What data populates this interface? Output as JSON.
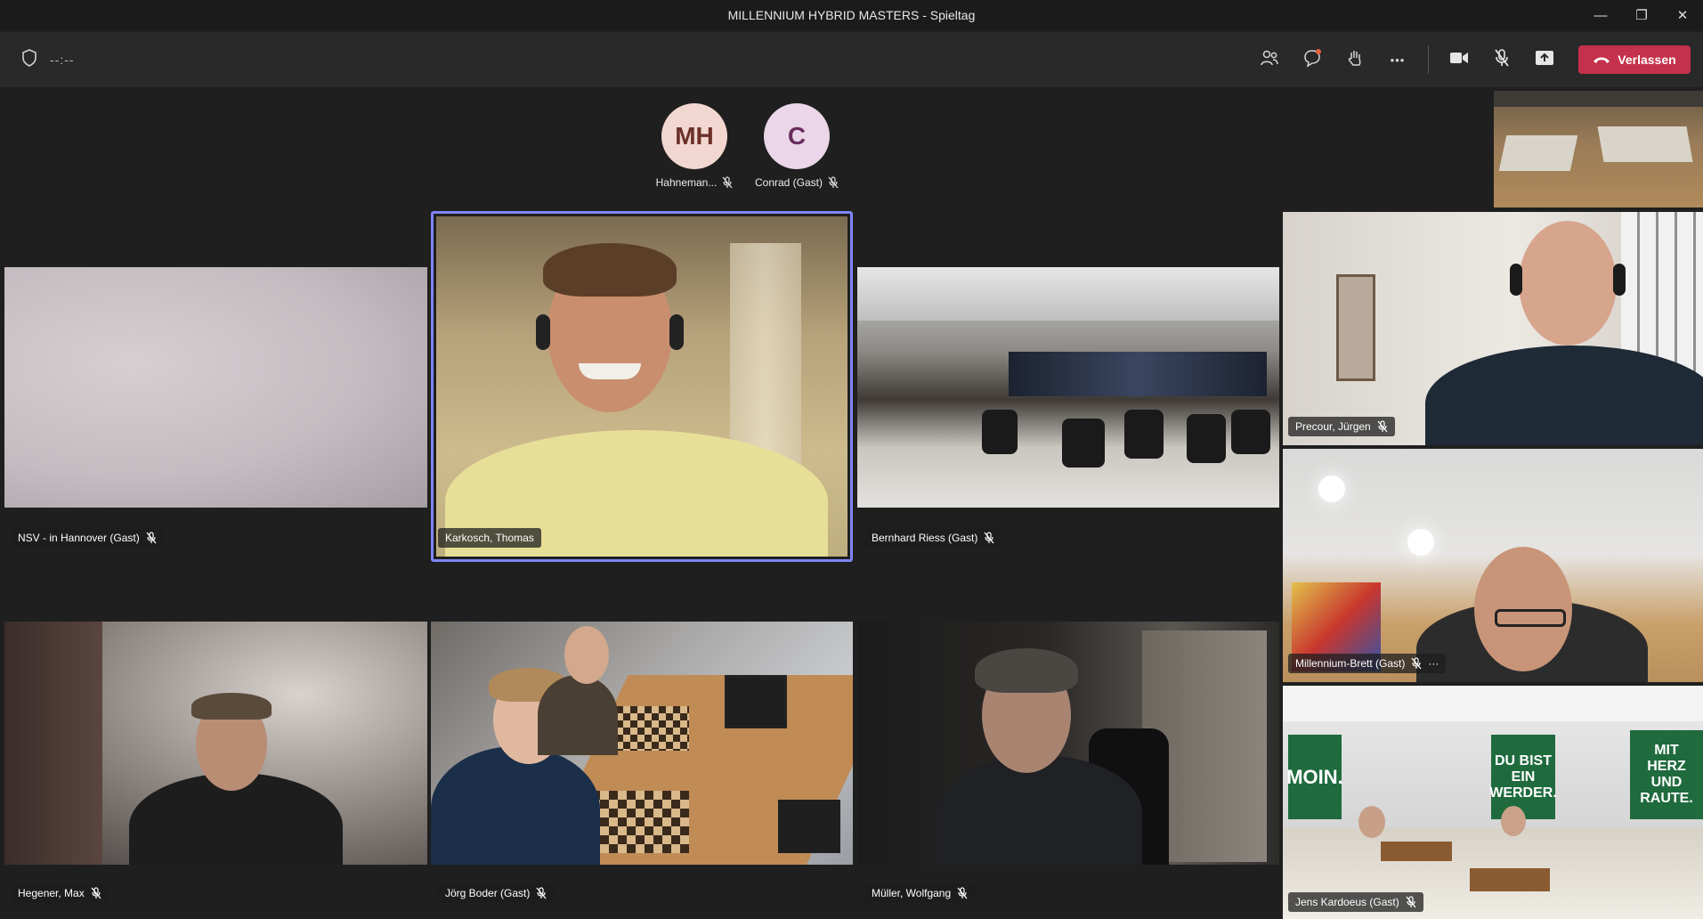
{
  "window": {
    "title": "MILLENNIUM HYBRID MASTERS - Spieltag",
    "minimize_icon": "—",
    "restore_icon": "❐",
    "close_icon": "✕"
  },
  "toolbar": {
    "timer": "--:--",
    "leave_label": "Verlassen",
    "more_label": "•••"
  },
  "audio_only": [
    {
      "initials": "MH",
      "name": "Hahneman...",
      "color": "#f2d6d0",
      "text_color": "#6b2f2a"
    },
    {
      "initials": "C",
      "name": "Conrad (Gast)",
      "color": "#ead6e8",
      "text_color": "#6a2d5f"
    }
  ],
  "participants": {
    "nsv": "NSV - in Hannover (Gast)",
    "karkosch": "Karkosch, Thomas",
    "riess": "Bernhard Riess (Gast)",
    "precour": "Precour, Jürgen",
    "millennium": "Millennium-Brett (Gast)",
    "millennium_more": "···",
    "hegener": "Hegener, Max",
    "boder": "Jörg Boder (Gast)",
    "mueller": "Müller, Wolfgang",
    "kardoeus": "Jens Kardoeus (Gast)"
  },
  "banners": {
    "moin": "MOIN.",
    "werder": "DU BIST EIN WERDER.",
    "raute": "MIT HERZ UND RAUTE."
  },
  "colors": {
    "active_speaker": "#7f85f5",
    "leave_button": "#c4314b",
    "toolbar": "#292929",
    "stage": "#1f1f1f"
  }
}
